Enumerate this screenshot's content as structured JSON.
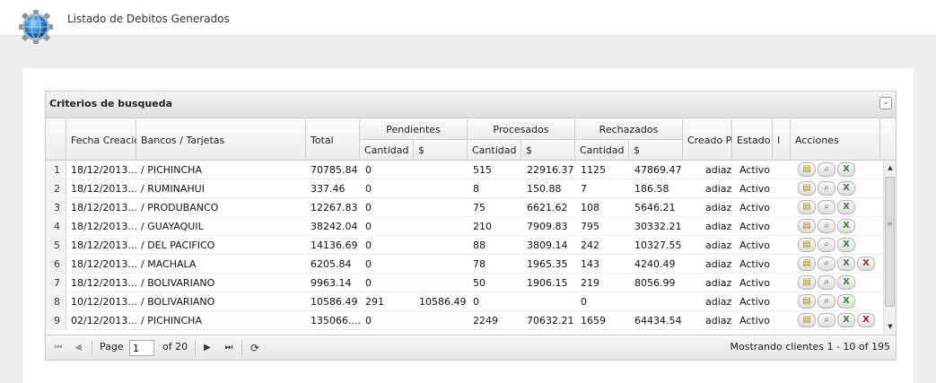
{
  "page": {
    "title": "Listado de Debitos Generados"
  },
  "grid": {
    "title": "Criterios de busqueda",
    "collapse_icon": "chevron-double-down-icon",
    "headers": {
      "fecha": "Fecha Creacion",
      "bancos": "Bancos / Tarjetas",
      "total": "Total",
      "pendientes": "Pendientes",
      "procesados": "Procesados",
      "rechazados": "Rechazados",
      "cantidad": "Cantidad",
      "dollar": "$",
      "creado_por": "Creado Por",
      "estado": "Estado",
      "i": "I",
      "acciones": "Acciones"
    },
    "rows": [
      {
        "n": "1",
        "fecha": "18/12/2013...",
        "banco": "/ PICHINCHA",
        "total": "70785.84",
        "pend_cant": "0",
        "pend_val": "",
        "proc_cant": "515",
        "proc_val": "22916.37",
        "rech_cant": "1125",
        "rech_val": "47869.47",
        "creado": "adiaz",
        "estado": "Activo",
        "actions": [
          "view-icon",
          "search-icon",
          "excel-icon"
        ]
      },
      {
        "n": "2",
        "fecha": "18/12/2013...",
        "banco": "/ RUMINAHUI",
        "total": "337.46",
        "pend_cant": "0",
        "pend_val": "",
        "proc_cant": "8",
        "proc_val": "150.88",
        "rech_cant": "7",
        "rech_val": "186.58",
        "creado": "adiaz",
        "estado": "Activo",
        "actions": [
          "view-icon",
          "search-icon",
          "excel-icon"
        ]
      },
      {
        "n": "3",
        "fecha": "18/12/2013...",
        "banco": "/ PRODUBANCO",
        "total": "12267.83",
        "pend_cant": "0",
        "pend_val": "",
        "proc_cant": "75",
        "proc_val": "6621.62",
        "rech_cant": "108",
        "rech_val": "5646.21",
        "creado": "adiaz",
        "estado": "Activo",
        "actions": [
          "view-icon",
          "search-icon",
          "excel-icon"
        ]
      },
      {
        "n": "4",
        "fecha": "18/12/2013...",
        "banco": "/ GUAYAQUIL",
        "total": "38242.04",
        "pend_cant": "0",
        "pend_val": "",
        "proc_cant": "210",
        "proc_val": "7909.83",
        "rech_cant": "795",
        "rech_val": "30332.21",
        "creado": "adiaz",
        "estado": "Activo",
        "actions": [
          "view-icon",
          "search-icon",
          "excel-icon"
        ]
      },
      {
        "n": "5",
        "fecha": "18/12/2013...",
        "banco": "/ DEL PACIFICO",
        "total": "14136.69",
        "pend_cant": "0",
        "pend_val": "",
        "proc_cant": "88",
        "proc_val": "3809.14",
        "rech_cant": "242",
        "rech_val": "10327.55",
        "creado": "adiaz",
        "estado": "Activo",
        "actions": [
          "view-icon",
          "search-icon",
          "excel-icon"
        ]
      },
      {
        "n": "6",
        "fecha": "18/12/2013...",
        "banco": "/ MACHALA",
        "total": "6205.84",
        "pend_cant": "0",
        "pend_val": "",
        "proc_cant": "78",
        "proc_val": "1965.35",
        "rech_cant": "143",
        "rech_val": "4240.49",
        "creado": "adiaz",
        "estado": "Activo",
        "actions": [
          "view-icon",
          "search-icon",
          "excel-icon",
          "excel-delete-icon"
        ]
      },
      {
        "n": "7",
        "fecha": "18/12/2013...",
        "banco": "/ BOLIVARIANO",
        "total": "9963.14",
        "pend_cant": "0",
        "pend_val": "",
        "proc_cant": "50",
        "proc_val": "1906.15",
        "rech_cant": "219",
        "rech_val": "8056.99",
        "creado": "adiaz",
        "estado": "Activo",
        "actions": [
          "view-icon",
          "search-icon",
          "excel-icon"
        ]
      },
      {
        "n": "8",
        "fecha": "10/12/2013...",
        "banco": "/ BOLIVARIANO",
        "total": "10586.49",
        "pend_cant": "291",
        "pend_val": "10586.49",
        "proc_cant": "0",
        "proc_val": "",
        "rech_cant": "0",
        "rech_val": "",
        "creado": "adiaz",
        "estado": "Activo",
        "actions": [
          "view-icon",
          "search-icon",
          "excel-icon"
        ]
      },
      {
        "n": "9",
        "fecha": "02/12/2013...",
        "banco": "/ PICHINCHA",
        "total": "135066....",
        "pend_cant": "0",
        "pend_val": "",
        "proc_cant": "2249",
        "proc_val": "70632.21",
        "rech_cant": "1659",
        "rech_val": "64434.54",
        "creado": "adiaz",
        "estado": "Activo",
        "actions": [
          "view-icon",
          "search-icon",
          "excel-icon",
          "excel-delete-icon"
        ]
      }
    ]
  },
  "pager": {
    "page_label": "Page",
    "page_value": "1",
    "of_label": "of 20",
    "status": "Mostrando clientes 1 - 10 of 195",
    "icons": [
      "first-page-icon",
      "prev-page-icon",
      "next-page-icon",
      "last-page-icon",
      "refresh-icon"
    ]
  }
}
